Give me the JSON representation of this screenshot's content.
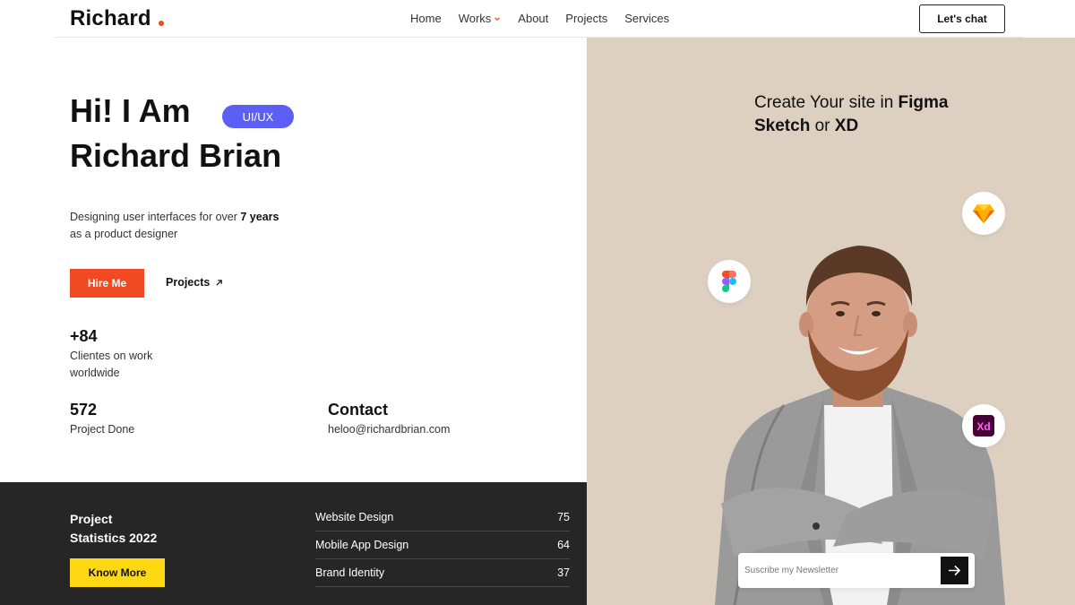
{
  "brand": {
    "logo_text": "Richard"
  },
  "nav": {
    "items": [
      {
        "label": "Home"
      },
      {
        "label": "Works"
      },
      {
        "label": "About"
      },
      {
        "label": "Projects"
      },
      {
        "label": "Services"
      }
    ],
    "cta_label": "Let's chat"
  },
  "hero": {
    "line1": "Hi! I Am",
    "line2": "Richard Brian",
    "badge": "UI/UX",
    "desc_prefix": "Designing user interfaces for over ",
    "desc_bold": "7 years",
    "desc_suffix": "as a product designer",
    "hire_label": "Hire Me",
    "projects_label": "Projects"
  },
  "stats": {
    "clients_num": "+84",
    "clients_label_1": "Clientes on work",
    "clients_label_2": "worldwide",
    "projects_num": "572",
    "projects_label": "Project Done",
    "contact_title": "Contact",
    "contact_email": "heloo@richardbrian.com"
  },
  "project_stats": {
    "title_1": "Project",
    "title_2": "Statistics 2022",
    "button_label": "Know More",
    "rows": [
      {
        "label": "Website Design",
        "value": "75"
      },
      {
        "label": "Mobile App Design",
        "value": "64"
      },
      {
        "label": "Brand Identity",
        "value": "37"
      }
    ]
  },
  "right": {
    "headline_1": "Create Your site in ",
    "headline_bold_1": "Figma",
    "headline_bold_2": "Sketch",
    "headline_or": " or ",
    "headline_bold_3": "XD",
    "app_icons": [
      "sketch-icon",
      "figma-icon",
      "adobe-xd-icon"
    ],
    "xd_text": "Xd"
  },
  "newsletter": {
    "placeholder": "Suscribe my Newsletter"
  },
  "colors": {
    "accent": "#f04a23",
    "badge": "#5b5ff6",
    "panel": "#ddd0c1",
    "dark": "#262626",
    "yellow": "#ffd814"
  }
}
